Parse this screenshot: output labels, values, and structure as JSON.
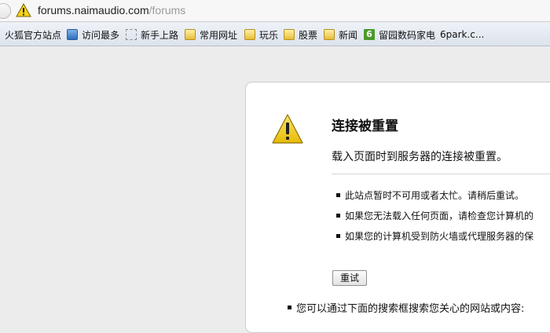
{
  "address_bar": {
    "url_host": "forums.naimaudio.com",
    "url_path": "/forums"
  },
  "bookmarks": [
    {
      "label": "火狐官方站点",
      "icon": "none"
    },
    {
      "label": "访问最多",
      "icon": "search-icon"
    },
    {
      "label": "新手上路",
      "icon": "dashed-page-icon"
    },
    {
      "label": "常用网址",
      "icon": "folder-icon"
    },
    {
      "label": "玩乐",
      "icon": "folder-icon"
    },
    {
      "label": "股票",
      "icon": "folder-icon"
    },
    {
      "label": "新闻",
      "icon": "folder-icon"
    },
    {
      "label": "留园数码家电",
      "icon": "six-icon",
      "icon_text": "6"
    },
    {
      "label": "6park.c...",
      "icon": "none"
    }
  ],
  "error_page": {
    "title": "连接被重置",
    "subtitle": "载入页面时到服务器的连接被重置。",
    "items": [
      "此站点暂时不可用或者太忙。请稍后重试。",
      "如果您无法载入任何页面，请检查您计算机的",
      "如果您的计算机受到防火墙或代理服务器的保"
    ],
    "retry_label": "重试",
    "search_note": "您可以通过下面的搜索框搜索您关心的网站或内容:"
  },
  "colors": {
    "warning_yellow": "#f5d21c",
    "page_background": "#ececec",
    "panel_background": "#ffffff"
  }
}
